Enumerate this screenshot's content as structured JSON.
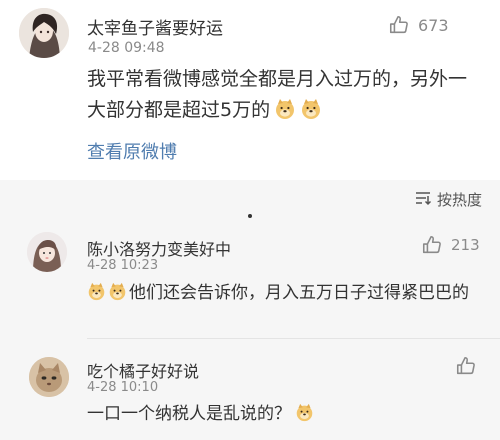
{
  "main_comment": {
    "username": "太宰鱼子酱要好运",
    "timestamp": "4-28 09:48",
    "like_count": "673",
    "text": "我平常看微博感觉全都是月入过万的，另外一大部分都是超过5万的",
    "emojis": [
      "doge-emoji",
      "doge-emoji"
    ],
    "view_original": "查看原微博"
  },
  "sort": {
    "label": "按热度"
  },
  "replies": [
    {
      "username": "陈小洛努力变美好中",
      "timestamp": "4-28 10:23",
      "like_count": "213",
      "text": "他们还会告诉你，月入五万日子过得紧巴巴的",
      "emojis": [
        "doge-emoji",
        "doge-emoji"
      ]
    },
    {
      "username": "吃个橘子好好说",
      "timestamp": "4-28 10:10",
      "like_count": "",
      "text": "一口一个纳税人是乱说的？",
      "emojis": [
        "doge-emoji"
      ]
    }
  ],
  "colors": {
    "link": "#507daf",
    "meta": "#8a8a8a",
    "sub_bg": "#f6f6f6"
  }
}
